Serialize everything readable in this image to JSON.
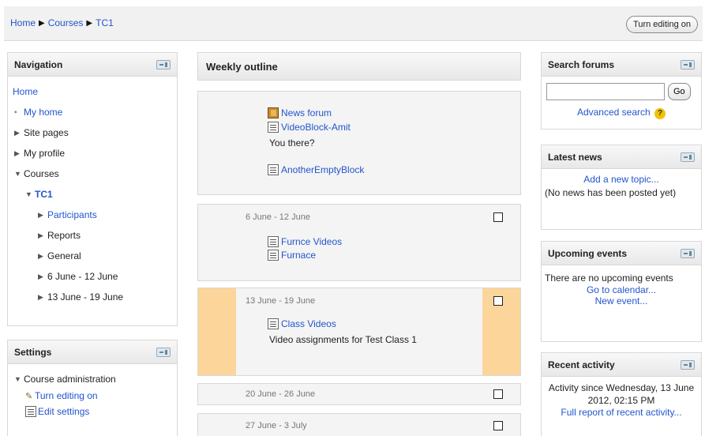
{
  "breadcrumb": {
    "home": "Home",
    "sep": "▶",
    "courses": "Courses",
    "current": "TC1"
  },
  "top_button": "Turn editing on",
  "navigation": {
    "title": "Navigation",
    "items": [
      {
        "label": "Home",
        "marker": "",
        "link": true
      },
      {
        "label": "My home",
        "marker": "▪",
        "link": true
      },
      {
        "label": "Site pages",
        "marker": "▶",
        "link": false
      },
      {
        "label": "My profile",
        "marker": "▶",
        "link": false
      },
      {
        "label": "Courses",
        "marker": "▼",
        "link": false
      },
      {
        "label": "TC1",
        "marker": "▼",
        "link": true
      },
      {
        "label": "Participants",
        "marker": "▶",
        "link": true
      },
      {
        "label": "Reports",
        "marker": "▶",
        "link": false
      },
      {
        "label": "General",
        "marker": "▶",
        "link": false
      },
      {
        "label": "6 June - 12 June",
        "marker": "▶",
        "link": false
      },
      {
        "label": "13 June - 19 June",
        "marker": "▶",
        "link": false
      }
    ]
  },
  "settings": {
    "title": "Settings",
    "course_admin": "Course administration",
    "turn_editing_on": "Turn editing on",
    "edit_settings": "Edit settings"
  },
  "outline": {
    "title": "Weekly outline",
    "section0": {
      "news_forum": "News forum",
      "video_block": "VideoBlock-Amit",
      "you_there": "You there?",
      "another_empty": "AnotherEmptyBlock"
    },
    "week1": {
      "date": "6 June - 12 June",
      "a1": "Furnce Videos",
      "a2": "Furnace"
    },
    "week2": {
      "date": "13 June - 19 June",
      "a1": "Class Videos",
      "note": "Video assignments for Test Class 1"
    },
    "week3": {
      "date": "20 June - 26 June"
    },
    "week4": {
      "date": "27 June - 3 July"
    }
  },
  "search_forums": {
    "title": "Search forums",
    "go": "Go",
    "advanced": "Advanced search",
    "help": "?"
  },
  "latest_news": {
    "title": "Latest news",
    "add": "Add a new topic...",
    "none": "(No news has been posted yet)"
  },
  "upcoming": {
    "title": "Upcoming events",
    "none": "There are no upcoming events",
    "calendar": "Go to calendar...",
    "new_event": "New event..."
  },
  "recent": {
    "title": "Recent activity",
    "since": "Activity since Wednesday, 13 June 2012, 02:15 PM",
    "full": "Full report of recent activity..."
  },
  "colors": {
    "link": "#2255cc",
    "current_week": "#fbd59a"
  }
}
